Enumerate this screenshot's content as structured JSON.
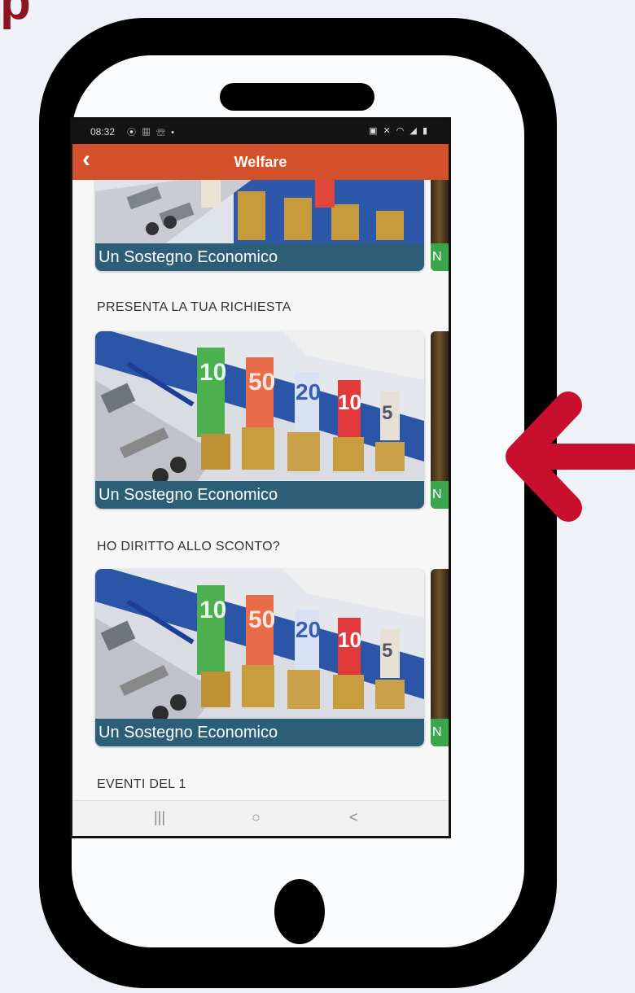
{
  "corner_text": "p",
  "status": {
    "time": "08:32",
    "left_icons": "⦿ ▦ ☏ •",
    "right_icons": "▣ ✕ ◠ ◢ ▮"
  },
  "appbar": {
    "back": "‹",
    "title": "Welfare"
  },
  "sections": [
    {
      "title": "",
      "card_caption": "Un Sostegno Economico",
      "peek_caption": "N"
    },
    {
      "title": "PRESENTA LA TUA RICHIESTA",
      "card_caption": "Un Sostegno Economico",
      "peek_caption": "N"
    },
    {
      "title": "HO DIRITTO ALLO SCONTO?",
      "card_caption": "Un Sostegno Economico",
      "peek_caption": "N"
    },
    {
      "title": "EVENTI DEL 1"
    }
  ],
  "navbar": {
    "recent": "|||",
    "home": "○",
    "back": "<"
  },
  "colors": {
    "appbar": "#d4502a",
    "caption": "#2c5e78",
    "peek_caption": "#3aa64c",
    "arrow": "#c8102e",
    "corner_text": "#8b1622"
  },
  "icons": {
    "back": "chevron-left-icon",
    "arrow": "arrow-left-icon",
    "nav_recent": "recent-apps-icon",
    "nav_home": "home-circle-icon",
    "nav_back": "nav-back-icon"
  }
}
